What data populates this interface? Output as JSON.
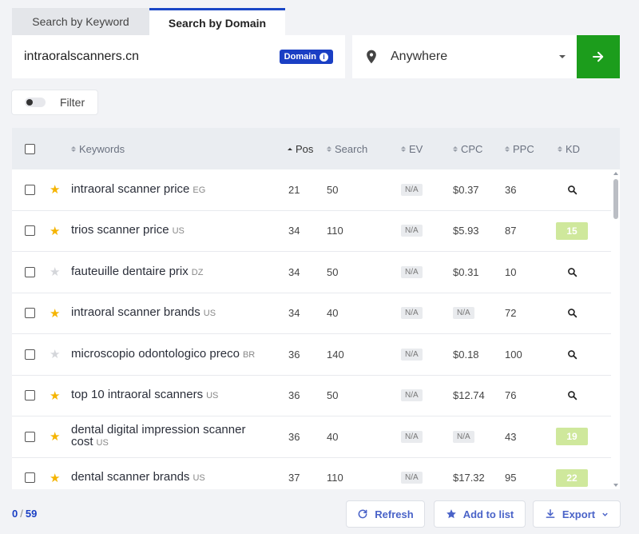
{
  "tabs": [
    {
      "label": "Search by Keyword",
      "active": false
    },
    {
      "label": "Search by Domain",
      "active": true
    }
  ],
  "search": {
    "domain_value": "intraoralscanners.cn",
    "badge_label": "Domain",
    "location_value": "Anywhere"
  },
  "filter": {
    "label": "Filter",
    "enabled": false
  },
  "columns": {
    "keywords": "Keywords",
    "pos": "Pos",
    "search": "Search",
    "ev": "EV",
    "cpc": "CPC",
    "ppc": "PPC",
    "kd": "KD"
  },
  "rows": [
    {
      "keyword": "intraoral scanner price",
      "country": "EG",
      "starred": true,
      "pos": "21",
      "search": "50",
      "ev": "N/A",
      "cpc": "$0.37",
      "ppc": "36",
      "kd": ""
    },
    {
      "keyword": "trios scanner price",
      "country": "US",
      "starred": true,
      "pos": "34",
      "search": "110",
      "ev": "N/A",
      "cpc": "$5.93",
      "ppc": "87",
      "kd": "15"
    },
    {
      "keyword": "fauteuille dentaire prix",
      "country": "DZ",
      "starred": false,
      "pos": "34",
      "search": "50",
      "ev": "N/A",
      "cpc": "$0.31",
      "ppc": "10",
      "kd": ""
    },
    {
      "keyword": "intraoral scanner brands",
      "country": "US",
      "starred": true,
      "pos": "34",
      "search": "40",
      "ev": "N/A",
      "cpc": "N/A",
      "ppc": "72",
      "kd": ""
    },
    {
      "keyword": "microscopio odontologico preco",
      "country": "BR",
      "starred": false,
      "pos": "36",
      "search": "140",
      "ev": "N/A",
      "cpc": "$0.18",
      "ppc": "100",
      "kd": ""
    },
    {
      "keyword": "top 10 intraoral scanners",
      "country": "US",
      "starred": true,
      "pos": "36",
      "search": "50",
      "ev": "N/A",
      "cpc": "$12.74",
      "ppc": "76",
      "kd": ""
    },
    {
      "keyword": "dental digital impression scanner cost",
      "country": "US",
      "starred": true,
      "pos": "36",
      "search": "40",
      "ev": "N/A",
      "cpc": "N/A",
      "ppc": "43",
      "kd": "19"
    },
    {
      "keyword": "dental scanner brands",
      "country": "US",
      "starred": true,
      "pos": "37",
      "search": "110",
      "ev": "N/A",
      "cpc": "$17.32",
      "ppc": "95",
      "kd": "22"
    }
  ],
  "footer": {
    "selected": "0",
    "separator": "/",
    "total": "59",
    "refresh_label": "Refresh",
    "add_to_list_label": "Add to list",
    "export_label": "Export"
  },
  "colors": {
    "accent": "#1a3fc4",
    "go_button": "#1c9d1c",
    "star_on": "#f5b400",
    "kd_badge": "#cfe89c"
  },
  "icons": {
    "pin": "map-pin-icon",
    "go": "arrow-right-icon",
    "refresh": "refresh-icon",
    "add": "star-icon",
    "export": "download-icon"
  }
}
